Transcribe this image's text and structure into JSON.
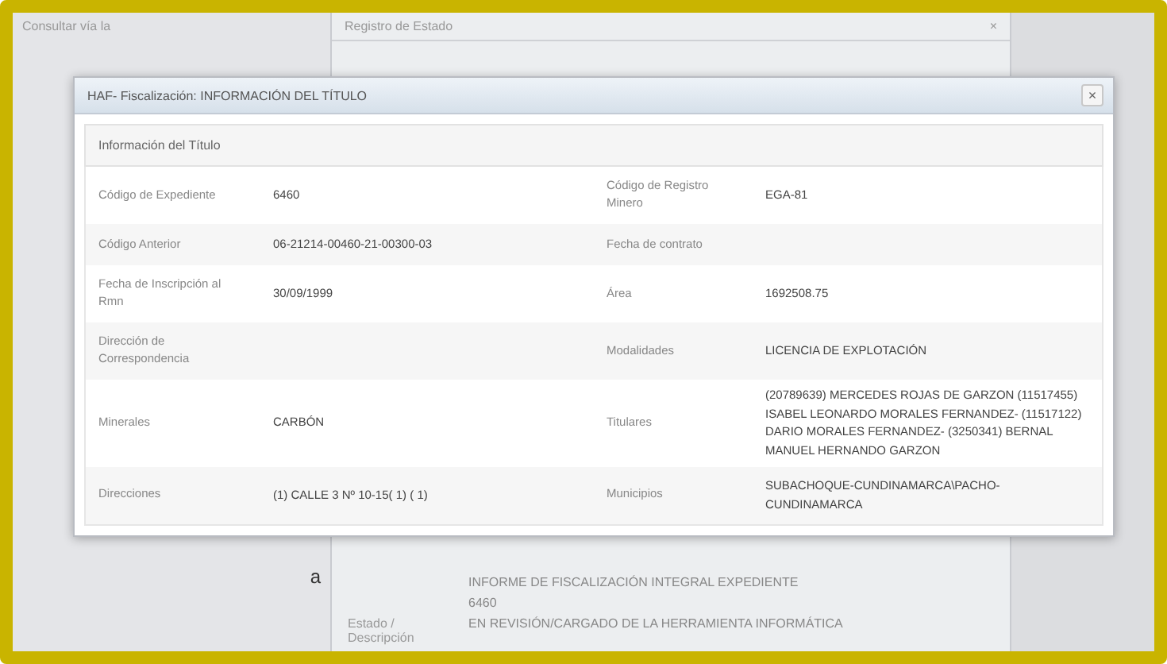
{
  "background": {
    "breadcrumb": "Consultar vía la",
    "window_title": "Registro de Estado",
    "left_text": "a",
    "rows": [
      {
        "text": "INFORME DE FISCALIZACIÓN INTEGRAL EXPEDIENTE"
      },
      {
        "text": "6460"
      },
      {
        "label": "Estado / Descripción",
        "text": "EN REVISIÓN/CARGADO DE LA HERRAMIENTA INFORMÁTICA"
      }
    ]
  },
  "dialog": {
    "title": "HAF- Fiscalización: INFORMACIÓN DEL TÍTULO",
    "close": "×",
    "section": "Información del Título",
    "rows": [
      {
        "label_1": "Código de Expediente",
        "value_1": "6460",
        "label_2": "Código de Registro Minero",
        "value_2": "EGA-81"
      },
      {
        "label_1": "Código Anterior",
        "value_1": "06-21214-00460-21-00300-03",
        "label_2": "Fecha de contrato"
      },
      {
        "label_1": "Fecha de Inscripción al Rmn",
        "value_1": "30/09/1999",
        "label_2": "Área",
        "value_2": "1692508.75"
      },
      {
        "label_1": "Dirección de Correspondencia",
        "label_2": "Modalidades",
        "value_2": "LICENCIA DE EXPLOTACIÓN"
      },
      {
        "label_1": "Minerales",
        "value_1": "CARBÓN",
        "label_2": "Titulares",
        "value_2": "(20789639) MERCEDES ROJAS DE GARZON (11517455) ISABEL LEONARDO MORALES FERNANDEZ- (11517122) DARIO MORALES FERNANDEZ- (3250341) BERNAL MANUEL HERNANDO GARZON"
      },
      {
        "label_1": "Direcciones",
        "value_1": "(1) CALLE 3 Nº 10-15( 1) ( 1)",
        "label_2": "Municipios",
        "value_2": "SUBACHOQUE-CUNDINAMARCA\\PACHO-CUNDINAMARCA"
      }
    ]
  }
}
